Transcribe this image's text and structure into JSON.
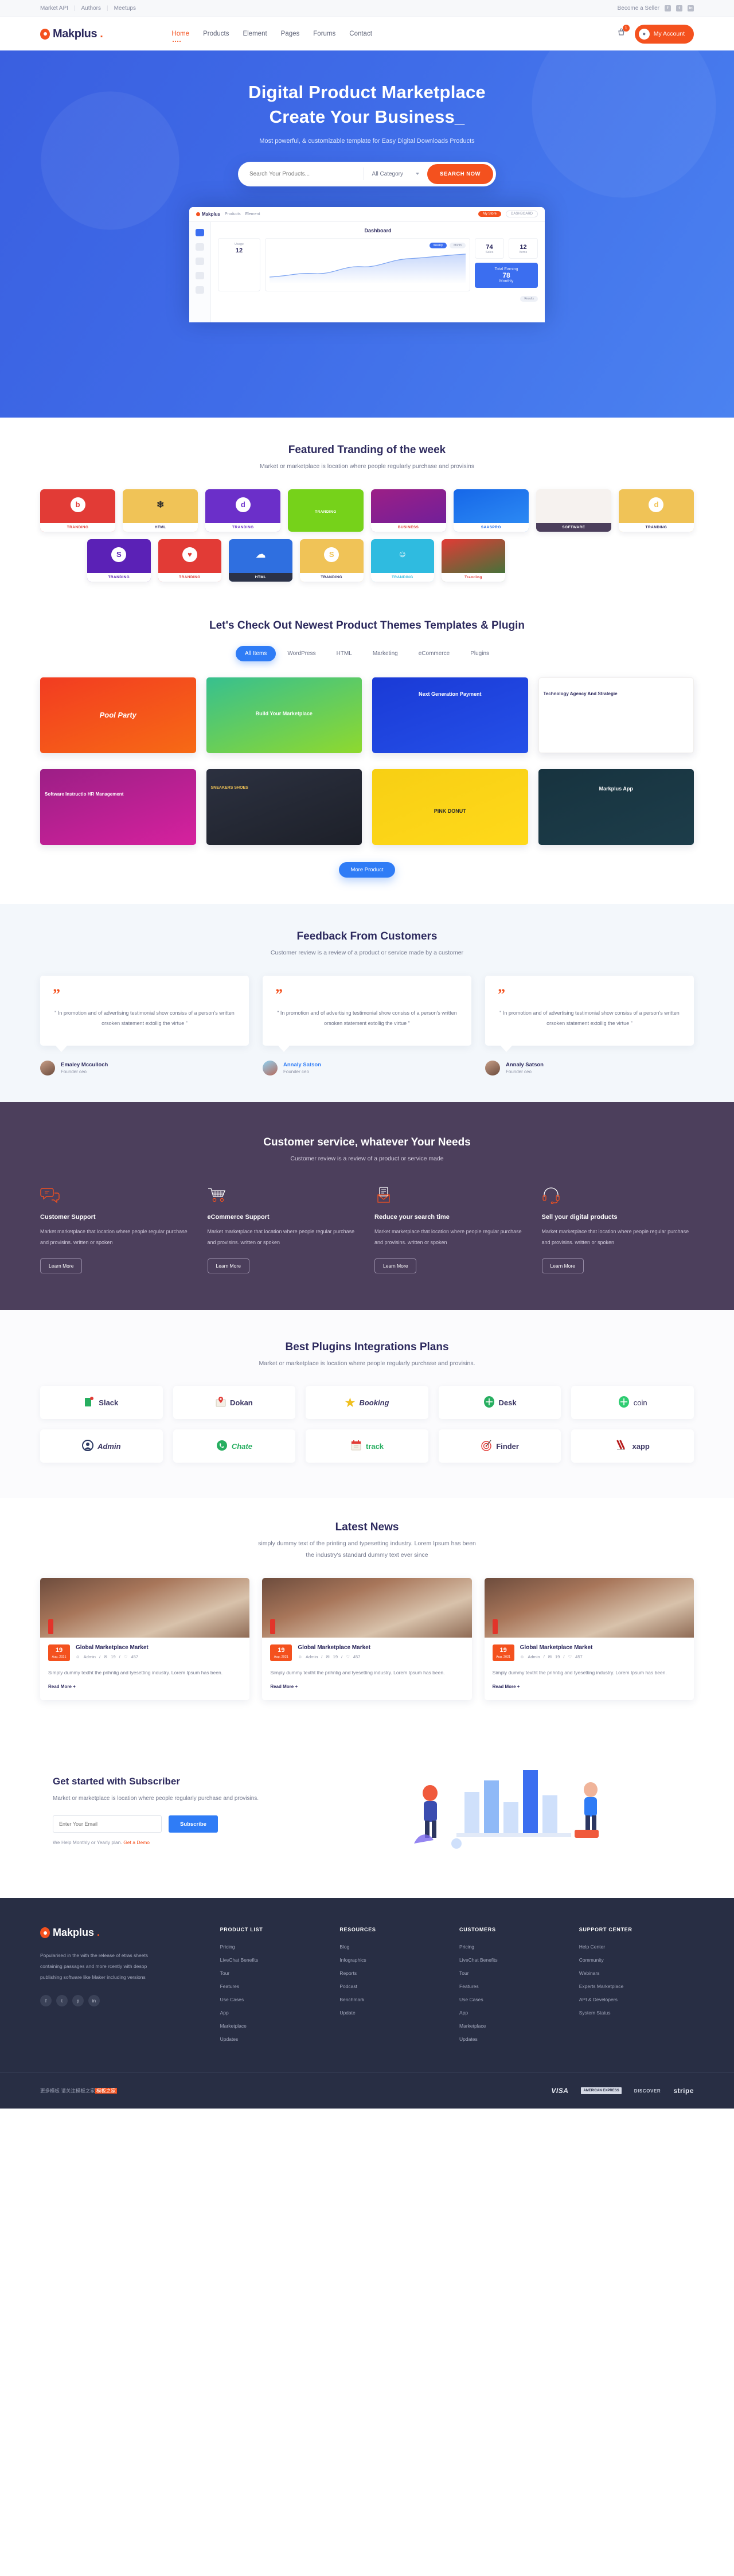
{
  "topbar": {
    "links": [
      "Market API",
      "Authors",
      "Meetups"
    ],
    "become_seller": "Become a Seller",
    "socials": [
      "f",
      "t",
      "in"
    ]
  },
  "nav": {
    "brand": "Makplus",
    "brand_dot": ".",
    "menu": [
      {
        "label": "Home",
        "active": true
      },
      {
        "label": "Products",
        "active": false
      },
      {
        "label": "Element",
        "active": false
      },
      {
        "label": "Pages",
        "active": false
      },
      {
        "label": "Forums",
        "active": false
      },
      {
        "label": "Contact",
        "active": false
      }
    ],
    "cart_count": "1",
    "account_label": "My Account"
  },
  "hero": {
    "title_line1": "Digital Product Marketplace",
    "title_line2": "Create Your Business_",
    "subtitle": "Most powerful, & customizable template for Easy Digital Downloads Products",
    "search_placeholder": "Search Your Products...",
    "category_label": "All Category",
    "search_button": "SEARCH NOW",
    "dashboard": {
      "brand": "Makplus",
      "nav": [
        "Products",
        "Element"
      ],
      "btn_primary": "My Store",
      "btn_ghost": "DASHBOARD",
      "title": "Dashboard",
      "stat1_label": "Usage",
      "stat1_value": "12",
      "stat1_sub": "+6",
      "chip_active": "Weekly",
      "chip_other": "Month",
      "tab_a": "Stats",
      "tab_b": "Reports",
      "kpi1_value": "74",
      "kpi1_label": "Sales",
      "kpi2_value": "12",
      "kpi2_label": "Items",
      "blue_label": "Total Earning",
      "blue_value": "78",
      "blue_sub": "Monthly",
      "footer_chip": "Results"
    }
  },
  "featured": {
    "title": "Featured Tranding of the week",
    "subtitle": "Market or marketplace is location where people regularly purchase and provisins",
    "row1": [
      {
        "label": "TRANDING",
        "bg": "#e23b36",
        "label_color": "#e23b36",
        "glyph": "b"
      },
      {
        "label": "HTML",
        "bg": "#f0c357",
        "label_color": "#2d2a5e",
        "glyph": "❄"
      },
      {
        "label": "TRANDING",
        "bg": "#6b2fc9",
        "label_color": "#6b2fc9",
        "glyph": "d"
      },
      {
        "label": "TRANDING",
        "bg": "#76d21a",
        "label_color": "#76d21a",
        "glyph": ""
      },
      {
        "label": "BUSINESS",
        "bg": "#9c1f86",
        "label_color": "#e23b36",
        "glyph": ""
      },
      {
        "label": "SAASPRO",
        "bg": "#1667e8",
        "label_color": "#1667e8",
        "glyph": ""
      },
      {
        "label": "SOFTWARE",
        "bg": "#f6f2ef",
        "label_color": "#4c3f5c",
        "glyph": ""
      },
      {
        "label": "TRANDING",
        "bg": "#f0c357",
        "label_color": "#2d2a5e",
        "glyph": "d"
      }
    ],
    "row2": [
      {
        "label": "TRANDING",
        "bg": "#5b21b6",
        "label_color": "#5b21b6",
        "glyph": "S"
      },
      {
        "label": "TRANDING",
        "bg": "#e23b36",
        "label_color": "#e23b36",
        "glyph": "♥"
      },
      {
        "label": "HTML",
        "bg": "#2f6fe0",
        "label_color": "#fff",
        "glyph": "☁"
      },
      {
        "label": "TRANDING",
        "bg": "#f0c357",
        "label_color": "#2d2a5e",
        "glyph": "S"
      },
      {
        "label": "TRANDING",
        "bg": "#2fbbe0",
        "label_color": "#2fbbe0",
        "glyph": "☺"
      },
      {
        "label": "Tranding",
        "bg": "#e23b36",
        "label_color": "#e23b36",
        "glyph": ""
      }
    ]
  },
  "products": {
    "title": "Let's Check Out Newest Product Themes Templates & Plugin",
    "tabs": [
      {
        "label": "All Items",
        "active": true
      },
      {
        "label": "WordPress",
        "active": false
      },
      {
        "label": "HTML",
        "active": false
      },
      {
        "label": "Marketing",
        "active": false
      },
      {
        "label": "eCommerce",
        "active": false
      },
      {
        "label": "Plugins",
        "active": false
      }
    ],
    "cards": [
      {
        "title": "Pool Party",
        "bg": "linear-gradient(160deg,#f23c21 0%,#f76a15 100%)"
      },
      {
        "title": "Build Your Marketplace",
        "bg": "linear-gradient(160deg,#37c08f 0%,#8fd92e 100%)"
      },
      {
        "title": "Next Generation Payment",
        "bg": "linear-gradient(160deg,#1a3ad6 0%,#2550e8 100%)"
      },
      {
        "title": "Technology Agency And Strategie",
        "bg": "linear-gradient(160deg,#ffffff 0%,#f6f2ef 100%)"
      },
      {
        "title": "Software Instructio HR Management",
        "bg": "linear-gradient(160deg,#9c1f86 0%,#d6219e 100%)"
      },
      {
        "title": "SNEAKERS SHOES",
        "bg": "linear-gradient(160deg,#2c3140 0%,#1d2029 100%)"
      },
      {
        "title": "PINK DONUT",
        "bg": "linear-gradient(160deg,#f7cf14 0%,#ffd91a 100%)"
      },
      {
        "title": "Markplus App",
        "bg": "linear-gradient(160deg,#17333f 0%,#1d3d4a 100%)"
      }
    ],
    "more_button": "More Product"
  },
  "feedback": {
    "title": "Feedback From Customers",
    "subtitle": "Customer review is a review of a product or service made by a customer",
    "items": [
      {
        "quote": "\" In promotion and of advertising testimonial show consiss of a person's written orsoken statement extollig the virtue \"",
        "name": "Emaley Mcculloch",
        "role": "Founder ceo",
        "link": false
      },
      {
        "quote": "\" In promotion and of advertising testimonial show consiss of a person's written orsoken statement extollig the virtue \"",
        "name": "Annaly Satson",
        "role": "Founder ceo",
        "link": true
      },
      {
        "quote": "\" In promotion and of advertising testimonial show consiss of a person's written orsoken statement extollig the virtue \"",
        "name": "Annaly Satson",
        "role": "Founder ceo",
        "link": false
      }
    ]
  },
  "services": {
    "title": "Customer service, whatever Your Needs",
    "subtitle": "Customer review is a review of a product or service made",
    "items": [
      {
        "icon": "chat-bubble-icon",
        "heading": "Customer Support",
        "text": "Market marketplace that location where people regular purchase and provisins. written or spoken",
        "button": "Learn More"
      },
      {
        "icon": "shopping-cart-icon",
        "heading": "eCommerce Support",
        "text": "Market marketplace that location where people regular purchase and provisins. written or spoken",
        "button": "Learn More"
      },
      {
        "icon": "envelope-document-icon",
        "heading": "Reduce your search time",
        "text": "Market marketplace that location where people regular purchase and provisins. written or spoken",
        "button": "Learn More"
      },
      {
        "icon": "headset-icon",
        "heading": "Sell your digital products",
        "text": "Market marketplace that location where people regular purchase and provisins. written or spoken",
        "button": "Learn More"
      }
    ]
  },
  "plugins": {
    "title": "Best Plugins Integrations Plans",
    "subtitle": "Market or marketplace is location where people regularly purchase and provisins.",
    "row1": [
      {
        "name": "Slack",
        "icon": "slack-icon",
        "icon_color": "#27ae60"
      },
      {
        "name": "Dokan",
        "icon": "map-pin-icon",
        "icon_color": "#e23b36"
      },
      {
        "name": "Booking",
        "icon": "star-icon",
        "icon_color": "#f0c020"
      },
      {
        "name": "Desk",
        "icon": "plus-circle-icon",
        "icon_color": "#27ae60"
      },
      {
        "name": "coin",
        "icon": "plus-circle-icon",
        "icon_color": "#2ecc71"
      }
    ],
    "row2": [
      {
        "name": "Admin",
        "icon": "user-circle-icon",
        "icon_color": "#2d3a63"
      },
      {
        "name": "Chate",
        "icon": "whatsapp-icon",
        "icon_color": "#27ae60"
      },
      {
        "name": "track",
        "icon": "calendar-icon",
        "icon_color": "#e23b36"
      },
      {
        "name": "Finder",
        "icon": "target-icon",
        "icon_color": "#e23b36"
      },
      {
        "name": "xapp",
        "icon": "brush-icon",
        "icon_color": "#b71c1c"
      }
    ]
  },
  "news": {
    "title": "Latest News",
    "subtitle_line1": "simply dummy text of the printing and typesetting industry. Lorem Ipsum has been",
    "subtitle_line2": "the industry's standard dummy text ever since",
    "items": [
      {
        "day": "19",
        "month": "Aug, 2021",
        "title": "Global Marketplace Market",
        "author": "Admin",
        "comments": "19",
        "likes": "457",
        "excerpt": "Simply dummy textht the prihntig and tyesetting industry. Lorem Ipsum has been.",
        "read_more": "Read More  +"
      },
      {
        "day": "19",
        "month": "Aug, 2021",
        "title": "Global Marketplace Market",
        "author": "Admin",
        "comments": "19",
        "likes": "457",
        "excerpt": "Simply dummy textht the prihntig and tyesetting industry. Lorem Ipsum has been.",
        "read_more": "Read More  +"
      },
      {
        "day": "19",
        "month": "Aug, 2021",
        "title": "Global Marketplace Market",
        "author": "Admin",
        "comments": "19",
        "likes": "457",
        "excerpt": "Simply dummy textht the prihntig and tyesetting industry. Lorem Ipsum has been.",
        "read_more": "Read More  +"
      }
    ]
  },
  "subscribe": {
    "heading": "Get started with Subscriber",
    "text": "Market or marketplace is location where people regularly purchase and provisins.",
    "email_placeholder": "Enter Your Email",
    "button": "Subscribe",
    "note_prefix": "We Help Monthly or Yearly plan.",
    "note_link": "Get a Demo"
  },
  "footer": {
    "brand": "Makplus",
    "brand_dot": ".",
    "description": "Popularised in the with the release of etras sheets containing passages and more rcently with desop publishing software like Maker including versions",
    "socials": [
      "f",
      "t",
      "p",
      "in"
    ],
    "columns": [
      {
        "title": "PRODUCT LIST",
        "links": [
          "Pricing",
          "LiveChat Benefits",
          "Tour",
          "Features",
          "Use Cases",
          "App",
          "Marketplace",
          "Updates"
        ]
      },
      {
        "title": "RESOURCES",
        "links": [
          "Blog",
          "Infographics",
          "Reports",
          "Podcast",
          "Benchmark",
          "Update"
        ]
      },
      {
        "title": "CUSTOMERS",
        "links": [
          "Pricing",
          "LiveChat Benefits",
          "Tour",
          "Features",
          "Use Cases",
          "App",
          "Marketplace",
          "Updates"
        ]
      },
      {
        "title": "SUPPORT CENTER",
        "links": [
          "Help Center",
          "Community",
          "Webinars",
          "Experts Marketplace",
          "API & Developers",
          "System Status"
        ]
      }
    ],
    "copyright_prefix": "更多模板 请关注模板之家",
    "copyright_highlight": "模板之家",
    "payments": [
      "VISA",
      "AMERICAN EXPRESS",
      "DISCOVER",
      "stripe"
    ]
  }
}
